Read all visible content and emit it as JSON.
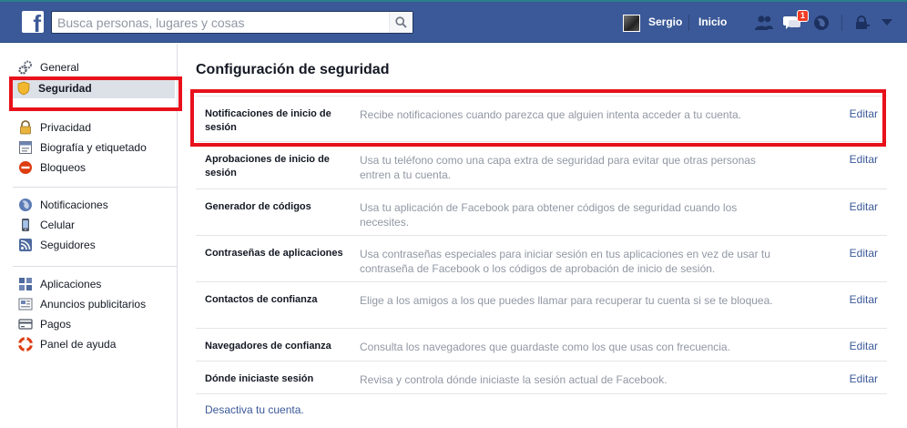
{
  "topbar": {
    "logo": "f",
    "search_placeholder": "Busca personas, lugares y cosas",
    "search_value": "",
    "user_name": "Sergio",
    "home_label": "Inicio",
    "notification_count": "1",
    "colors": {
      "bar": "#3b5998",
      "badge": "#f03d25"
    },
    "icons": [
      "search-icon",
      "friend-requests-icon",
      "messages-icon",
      "globe-icon",
      "privacy-lock-icon",
      "dropdown-arrow-icon"
    ]
  },
  "sidebar": {
    "group1": [
      {
        "label": "General",
        "icon": "gears-icon"
      },
      {
        "label": "Seguridad",
        "icon": "shield-icon",
        "active": true
      }
    ],
    "group2": [
      {
        "label": "Privacidad",
        "icon": "padlock-icon"
      },
      {
        "label": "Biografía y etiquetado",
        "icon": "timeline-icon"
      },
      {
        "label": "Bloqueos",
        "icon": "block-icon"
      }
    ],
    "group3": [
      {
        "label": "Notificaciones",
        "icon": "globe-icon"
      },
      {
        "label": "Celular",
        "icon": "mobile-icon"
      },
      {
        "label": "Seguidores",
        "icon": "rss-icon"
      }
    ],
    "group4": [
      {
        "label": "Aplicaciones",
        "icon": "apps-icon"
      },
      {
        "label": "Anuncios publicitarios",
        "icon": "ads-icon"
      },
      {
        "label": "Pagos",
        "icon": "payments-icon"
      },
      {
        "label": "Panel de ayuda",
        "icon": "lifebuoy-icon"
      }
    ]
  },
  "main": {
    "title": "Configuración de seguridad",
    "edit_label": "Editar",
    "rows": [
      {
        "name": "Notificaciones de inicio de sesión",
        "desc": "Recibe notificaciones cuando parezca que alguien intenta acceder a tu cuenta."
      },
      {
        "name": "Aprobaciones de inicio de sesión",
        "desc": "Usa tu teléfono como una capa extra de seguridad para evitar que otras personas entren a tu cuenta."
      },
      {
        "name": "Generador de códigos",
        "desc": "Usa tu aplicación de Facebook para obtener códigos de seguridad cuando los necesites."
      },
      {
        "name": "Contraseñas de aplicaciones",
        "desc": "Usa contraseñas especiales para iniciar sesión en tus aplicaciones en vez de usar tu contraseña de Facebook o los códigos de aprobación de inicio de sesión."
      },
      {
        "name": "Contactos de confianza",
        "desc": "Elige a los amigos a los que puedes llamar para recuperar tu cuenta si se te bloquea."
      },
      {
        "name": "Navegadores de confianza",
        "desc": "Consulta los navegadores que guardaste como los que usas con frecuencia."
      },
      {
        "name": "Dónde iniciaste sesión",
        "desc": "Revisa y controla dónde iniciaste la sesión actual de Facebook."
      }
    ],
    "deactivate_label": "Desactiva tu cuenta."
  }
}
